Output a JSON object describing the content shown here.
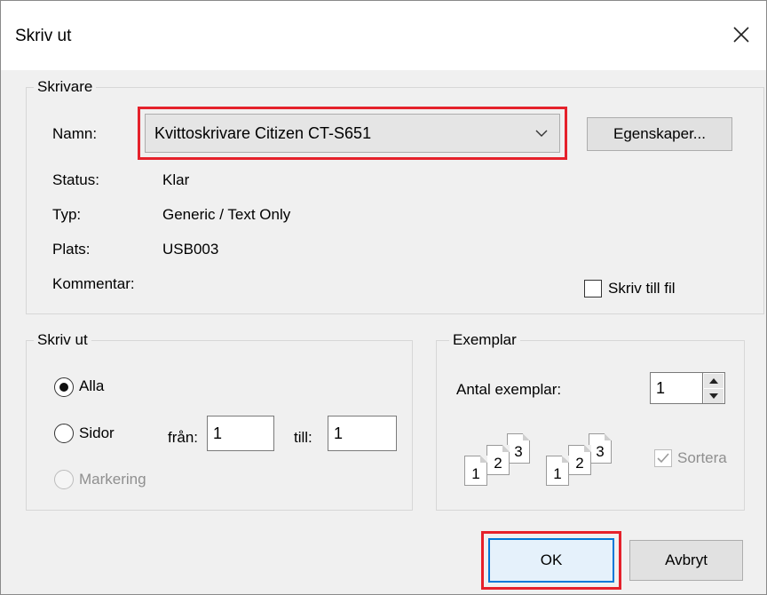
{
  "dialog": {
    "title": "Skriv ut"
  },
  "printer": {
    "group_label": "Skrivare",
    "name_label": "Namn:",
    "selected": "Kvittoskrivare Citizen CT-S651",
    "properties_button": "Egenskaper...",
    "status_label": "Status:",
    "status_value": "Klar",
    "type_label": "Typ:",
    "type_value": "Generic / Text Only",
    "location_label": "Plats:",
    "location_value": "USB003",
    "comment_label": "Kommentar:",
    "print_to_file_label": "Skriv till fil",
    "print_to_file_checked": false
  },
  "print_range": {
    "group_label": "Skriv ut",
    "all_label": "Alla",
    "pages_label": "Sidor",
    "from_label": "från:",
    "from_value": "1",
    "to_label": "till:",
    "to_value": "1",
    "selection_label": "Markering",
    "selected_option": "Alla"
  },
  "copies": {
    "group_label": "Exemplar",
    "count_label": "Antal exemplar:",
    "count_value": "1",
    "collate_label": "Sortera",
    "collate_checked": true,
    "page_numbers": [
      "1",
      "2",
      "3"
    ]
  },
  "buttons": {
    "ok": "OK",
    "cancel": "Avbryt"
  },
  "colors": {
    "highlight": "#e5212b",
    "focus": "#0078d7"
  }
}
